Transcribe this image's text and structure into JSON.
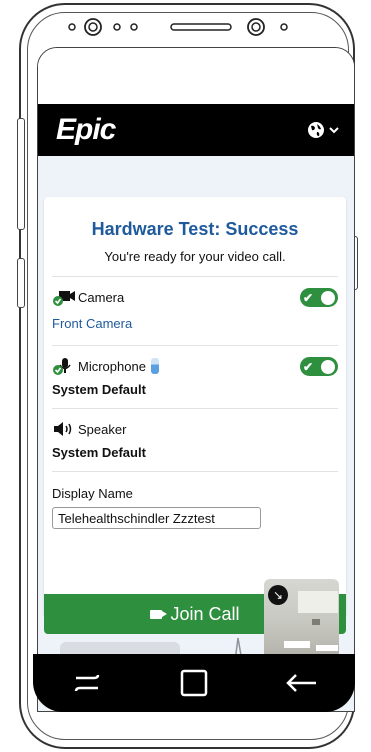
{
  "app": {
    "logo_text": "Epic"
  },
  "header": {
    "language_icon": "globe-icon",
    "chevron_icon": "chevron-down-icon"
  },
  "card": {
    "title": "Hardware Test: Success",
    "subtitle": "You're ready for your video call."
  },
  "devices": {
    "camera": {
      "label": "Camera",
      "value": "Front Camera",
      "enabled": true,
      "icon": "camera-icon"
    },
    "microphone": {
      "label": "Microphone",
      "value": "System Default",
      "enabled": true,
      "icon": "microphone-icon"
    },
    "speaker": {
      "label": "Speaker",
      "value": "System Default",
      "icon": "speaker-icon"
    }
  },
  "display_name": {
    "label": "Display Name",
    "value": "Telehealthschindler Zzztest"
  },
  "join_button": {
    "label": "Join Call",
    "icon": "video-camera-icon"
  },
  "colors": {
    "accent_blue": "#1e5a9c",
    "success_green": "#2e8f3e",
    "header_bg": "#000000",
    "page_bg": "#eef3f9"
  },
  "nav": {
    "items": [
      "recent-apps-icon",
      "home-icon",
      "back-icon"
    ]
  }
}
